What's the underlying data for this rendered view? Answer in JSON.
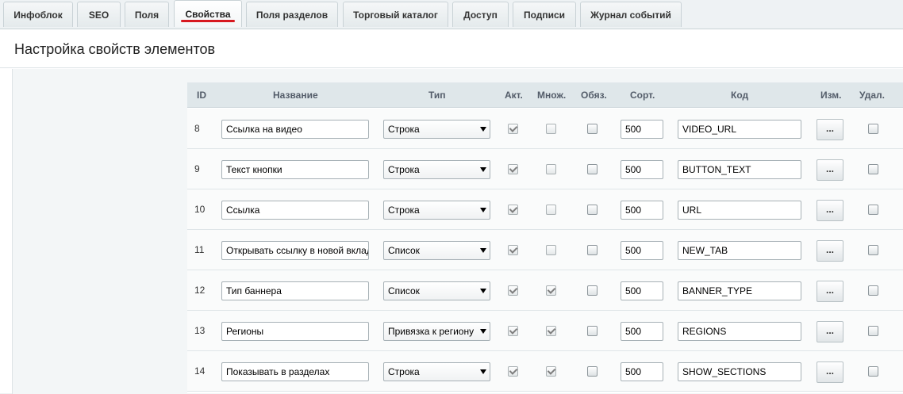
{
  "tabs": [
    {
      "label": "Инфоблок",
      "active": false
    },
    {
      "label": "SEO",
      "active": false
    },
    {
      "label": "Поля",
      "active": false
    },
    {
      "label": "Свойства",
      "active": true
    },
    {
      "label": "Поля разделов",
      "active": false
    },
    {
      "label": "Торговый каталог",
      "active": false
    },
    {
      "label": "Доступ",
      "active": false
    },
    {
      "label": "Подписи",
      "active": false
    },
    {
      "label": "Журнал событий",
      "active": false
    }
  ],
  "page": {
    "title": "Настройка свойств элементов"
  },
  "columns": {
    "id": "ID",
    "name": "Название",
    "type": "Тип",
    "active": "Акт.",
    "multiple": "Множ.",
    "required": "Обяз.",
    "sort": "Сорт.",
    "code": "Код",
    "edit": "Изм.",
    "delete": "Удал."
  },
  "edit_button_label": "...",
  "rows": [
    {
      "id": "8",
      "name": "Ссылка на видео",
      "type": "Строка",
      "active": true,
      "multiple": false,
      "required": false,
      "sort": "500",
      "code": "VIDEO_URL",
      "delete": false
    },
    {
      "id": "9",
      "name": "Текст кнопки",
      "type": "Строка",
      "active": true,
      "multiple": false,
      "required": false,
      "sort": "500",
      "code": "BUTTON_TEXT",
      "delete": false
    },
    {
      "id": "10",
      "name": "Ссылка",
      "type": "Строка",
      "active": true,
      "multiple": false,
      "required": false,
      "sort": "500",
      "code": "URL",
      "delete": false
    },
    {
      "id": "11",
      "name": "Открывать ссылку в новой вкладке",
      "type": "Список",
      "active": true,
      "multiple": false,
      "required": false,
      "sort": "500",
      "code": "NEW_TAB",
      "delete": false
    },
    {
      "id": "12",
      "name": "Тип баннера",
      "type": "Список",
      "active": true,
      "multiple": true,
      "required": false,
      "sort": "500",
      "code": "BANNER_TYPE",
      "delete": false
    },
    {
      "id": "13",
      "name": "Регионы",
      "type": "Привязка к региону",
      "active": true,
      "multiple": true,
      "required": false,
      "sort": "500",
      "code": "REGIONS",
      "delete": false
    },
    {
      "id": "14",
      "name": "Показывать в разделах",
      "type": "Строка",
      "active": true,
      "multiple": true,
      "required": false,
      "sort": "500",
      "code": "SHOW_SECTIONS",
      "delete": false
    }
  ]
}
